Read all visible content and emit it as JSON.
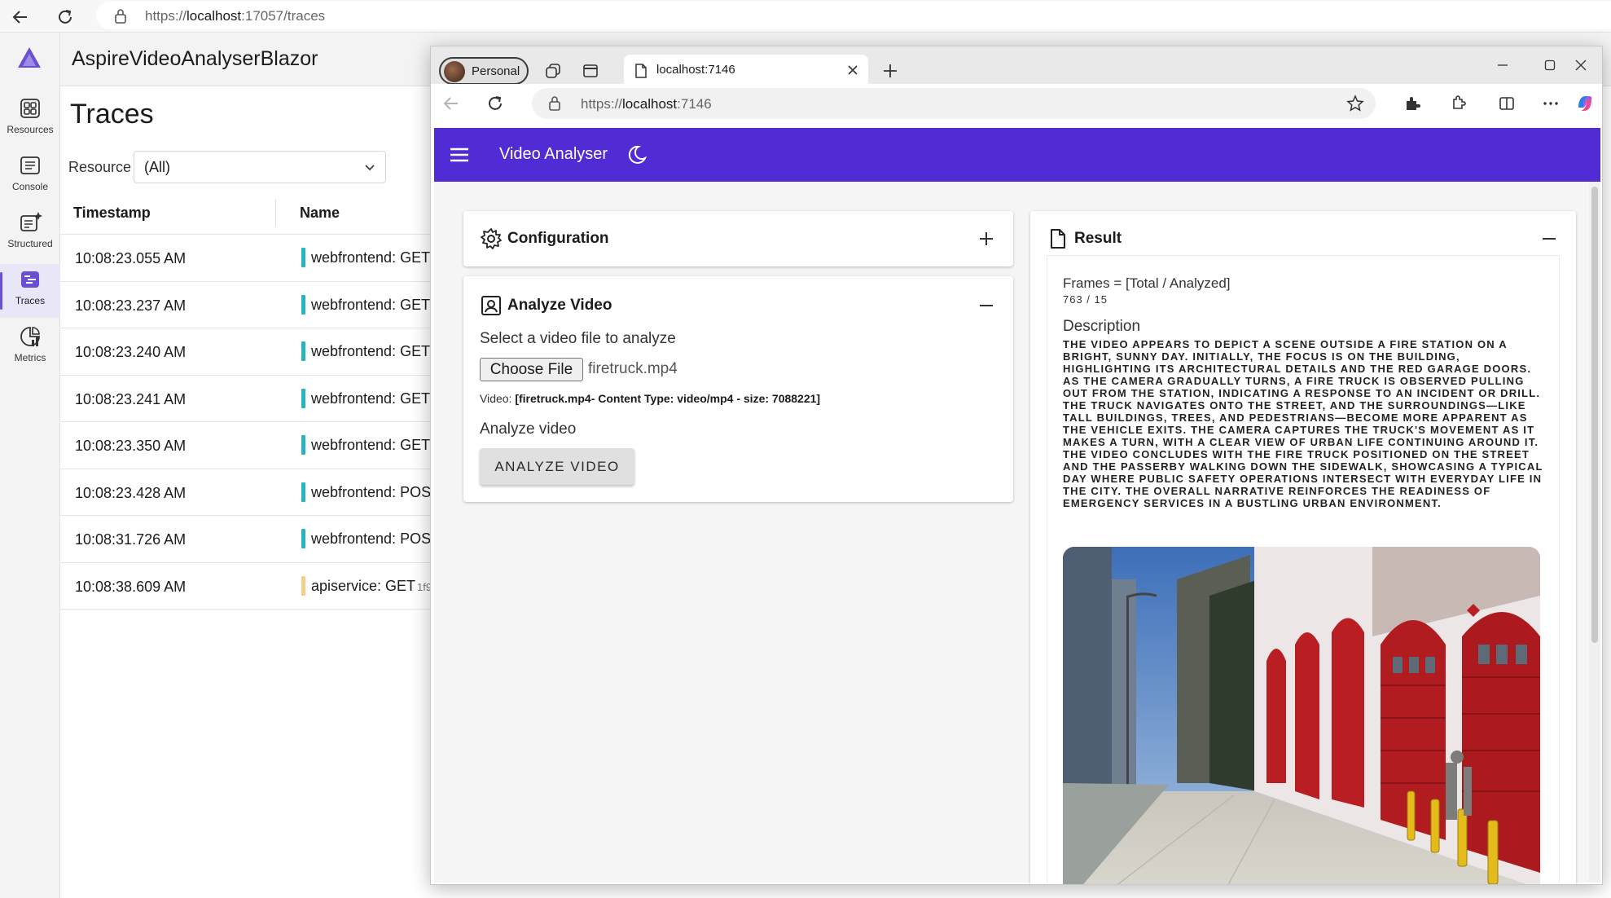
{
  "outer_browser": {
    "url_prefix": "https://",
    "url_host": "localhost",
    "url_rest": ":17057/traces"
  },
  "dashboard": {
    "app_title": "AspireVideoAnalyserBlazor",
    "nav": [
      {
        "label": "Resources",
        "icon": "resources-grid-icon"
      },
      {
        "label": "Console",
        "icon": "console-icon"
      },
      {
        "label": "Structured",
        "icon": "structured-logs-icon"
      },
      {
        "label": "Traces",
        "icon": "traces-icon",
        "active": true
      },
      {
        "label": "Metrics",
        "icon": "metrics-icon"
      }
    ],
    "page_title": "Traces",
    "filter": {
      "label": "Resource",
      "value": "(All)"
    },
    "table": {
      "columns": [
        "Timestamp",
        "Name"
      ],
      "rows": [
        {
          "ts": "10:08:23.055 AM",
          "name": "webfrontend: GET /",
          "color": "#2ab3bb"
        },
        {
          "ts": "10:08:23.237 AM",
          "name": "webfrontend: GET",
          "color": "#2ab3bb"
        },
        {
          "ts": "10:08:23.240 AM",
          "name": "webfrontend: GET",
          "color": "#2ab3bb"
        },
        {
          "ts": "10:08:23.241 AM",
          "name": "webfrontend: GET",
          "color": "#2ab3bb"
        },
        {
          "ts": "10:08:23.350 AM",
          "name": "webfrontend: GET /",
          "color": "#2ab3bb"
        },
        {
          "ts": "10:08:23.428 AM",
          "name": "webfrontend: POST",
          "color": "#2ab3bb"
        },
        {
          "ts": "10:08:31.726 AM",
          "name": "webfrontend: POST",
          "color": "#2ab3bb"
        },
        {
          "ts": "10:08:38.609 AM",
          "name": "apiservice: GET",
          "sub": "1f9",
          "color": "#f2d08a"
        }
      ]
    }
  },
  "edge": {
    "profile": "Personal",
    "tab_title": "localhost:7146",
    "url_prefix": "https://",
    "url_host": "localhost",
    "url_rest": ":7146"
  },
  "app": {
    "title": "Video Analyser",
    "accent": "#512bd4",
    "configuration": {
      "title": "Configuration"
    },
    "analyze": {
      "title": "Analyze Video",
      "select_label": "Select a video file to analyze",
      "choose_file": "Choose File",
      "file_name": "firetruck.mp4",
      "info_prefix": "Video: ",
      "info_value": "[firetruck.mp4- Content Type: video/mp4 - size: 7088221]",
      "analyze_label": "Analyze video",
      "button": "ANALYZE VIDEO"
    },
    "result": {
      "title": "Result",
      "frames_label": "Frames = [Total / Analyzed]",
      "frames_value": "763 / 15",
      "description_label": "Description",
      "description": "The video appears to depict a scene outside a fire station on a bright, sunny day. Initially, the focus is on the building, highlighting its architectural details and the red garage doors. As the camera gradually turns, a fire truck is observed pulling out from the station, indicating a response to an incident or drill. The truck navigates onto the street, and the surroundings—like tall buildings, trees, and pedestrians—become more apparent as the vehicle exits. The camera captures the truck's movement as it makes a turn, with a clear view of urban life continuing around it. The video concludes with the fire truck positioned on the street and the passerby walking down the sidewalk, showcasing a typical day where public safety operations intersect with everyday life in the city. The overall narrative reinforces the readiness of emergency services in a bustling urban environment."
    }
  }
}
